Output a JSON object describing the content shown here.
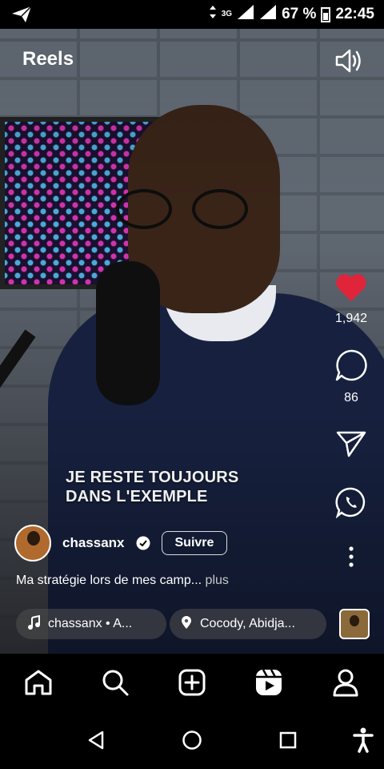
{
  "status_bar": {
    "network": "3G",
    "battery": "67 %",
    "time": "22:45"
  },
  "header": {
    "title": "Reels",
    "sound_icon": "speaker-on-icon"
  },
  "video": {
    "caption_line1": "JE RESTE TOUJOURS",
    "caption_line2": "DANS L'EXEMPLE"
  },
  "actions": {
    "likes": "1,942",
    "comments": "86",
    "like_color": "#e0243a"
  },
  "post": {
    "username": "chassanx",
    "follow_label": "Suivre",
    "description": "Ma stratégie lors de mes camp...",
    "more": " plus",
    "audio": "chassanx • A...",
    "location": "Cocody, Abidja..."
  },
  "tabbar": {
    "icons": [
      "home-icon",
      "search-icon",
      "create-icon",
      "reels-icon",
      "profile-icon"
    ]
  },
  "system_nav": {
    "icons": [
      "back-icon",
      "home-circle-icon",
      "recents-icon",
      "accessibility-icon"
    ]
  }
}
